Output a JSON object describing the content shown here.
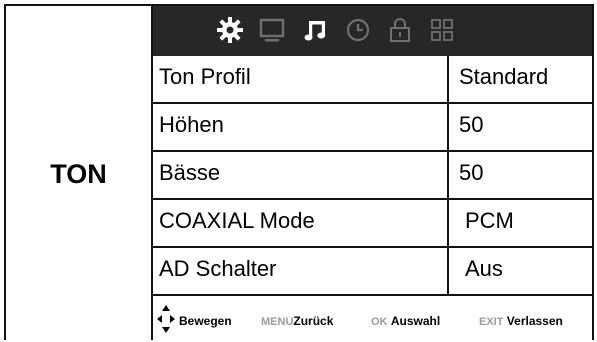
{
  "section_title": "TON",
  "icons": [
    "gear-icon",
    "monitor-icon",
    "music-note-icon",
    "clock-icon",
    "lock-icon",
    "grid-icon"
  ],
  "rows": [
    {
      "label": "Ton Profil",
      "value": "Standard"
    },
    {
      "label": "Höhen",
      "value": "50"
    },
    {
      "label": "Bässe",
      "value": "50"
    },
    {
      "label": "COAXIAL Mode",
      "value": "PCM"
    },
    {
      "label": "AD Schalter",
      "value": "Aus"
    }
  ],
  "footer": {
    "move": "Bewegen",
    "menu_key": "MENU",
    "menu_action": "Zurück",
    "ok_key": "OK",
    "ok_action": "Auswahl",
    "exit_key": "EXIT",
    "exit_action": "Verlassen"
  },
  "colors": {
    "icon_bar_bg": "#272727",
    "active_icon": "#ffffff",
    "inactive_icon": "#6f6f6f"
  }
}
